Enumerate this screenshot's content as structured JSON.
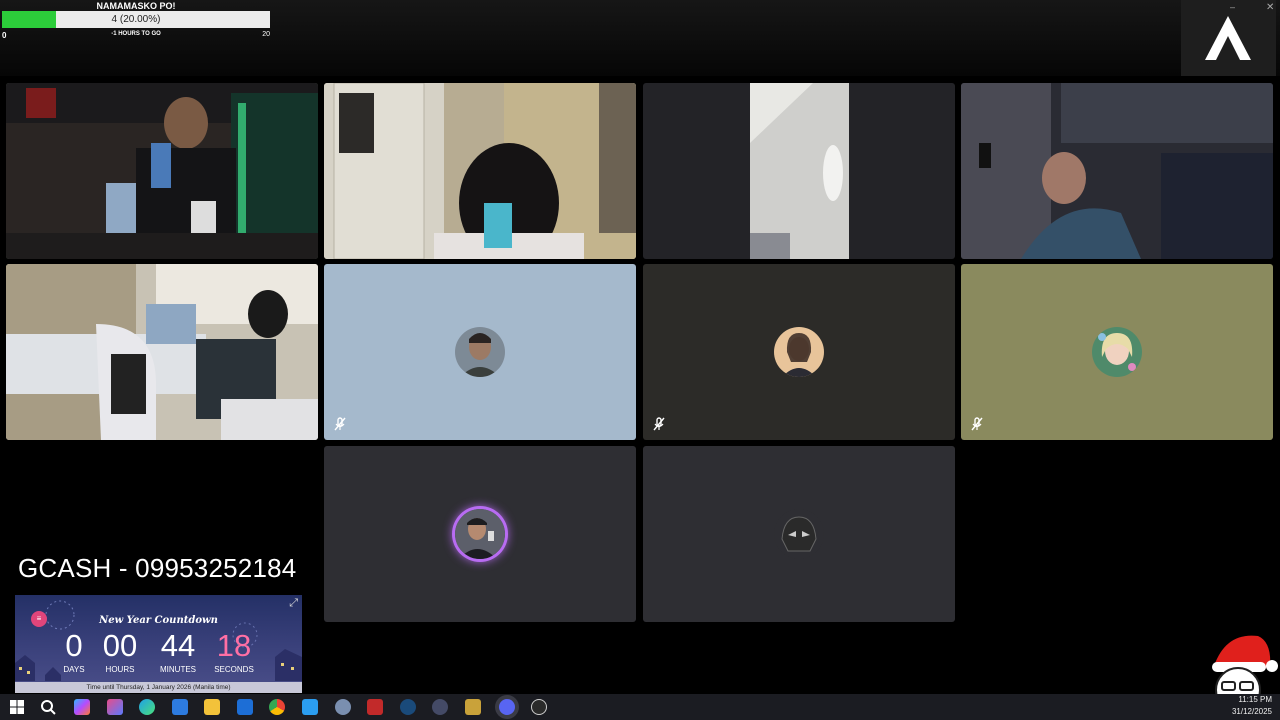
{
  "goal": {
    "title": "NAMAMASKO PO!",
    "value_text": "4 (20.00%)",
    "progress": 0.2,
    "min_label": "0",
    "max_label": "20",
    "sub_label": "-1 HOURS TO GO"
  },
  "window": {
    "minimize_symbol": "–",
    "close_symbol": "✕"
  },
  "tiles": [
    {
      "kind": "video",
      "scene": "man-in-studio",
      "speaking": true
    },
    {
      "kind": "video",
      "scene": "girl-at-mic"
    },
    {
      "kind": "video",
      "scene": "doorway"
    },
    {
      "kind": "video",
      "scene": "woman-in-dark-room"
    },
    {
      "kind": "video",
      "scene": "bedroom-gaming-chair"
    },
    {
      "kind": "avatar",
      "bg": "#a5b9cc",
      "muted": true
    },
    {
      "kind": "avatar",
      "bg": "#2c2b28",
      "muted": true
    },
    {
      "kind": "avatar",
      "bg": "#8a8a5e",
      "muted": true
    },
    {
      "kind": "avatar",
      "bg": "#2e2e33",
      "ring": "#b86cf2"
    },
    {
      "kind": "avatar",
      "bg": "#2e2e33"
    }
  ],
  "overlay": {
    "gcash": "GCASH - 09953252184"
  },
  "countdown": {
    "title": "New Year Countdown",
    "days": "0",
    "hours": "00",
    "minutes": "44",
    "seconds": "18",
    "days_label": "DAYS",
    "hours_label": "HOURS",
    "minutes_label": "MINUTES",
    "seconds_label": "SECONDS",
    "footer": "Time until Thursday, 1 January 2026 (Manila time)",
    "seconds_color": "#ff6fa4"
  },
  "taskbar": {
    "icons": [
      "windows-start",
      "search",
      "copilot",
      "photos",
      "edge",
      "microsoft-store",
      "file-explorer",
      "mail",
      "chrome",
      "vs-code-blue",
      "screenshot",
      "voicemeeter",
      "steam",
      "audio-app",
      "tool-app",
      "discord",
      "obs"
    ],
    "active_icon": "discord",
    "clock_time": "11:15 PM",
    "clock_date": "31/12/2025"
  }
}
